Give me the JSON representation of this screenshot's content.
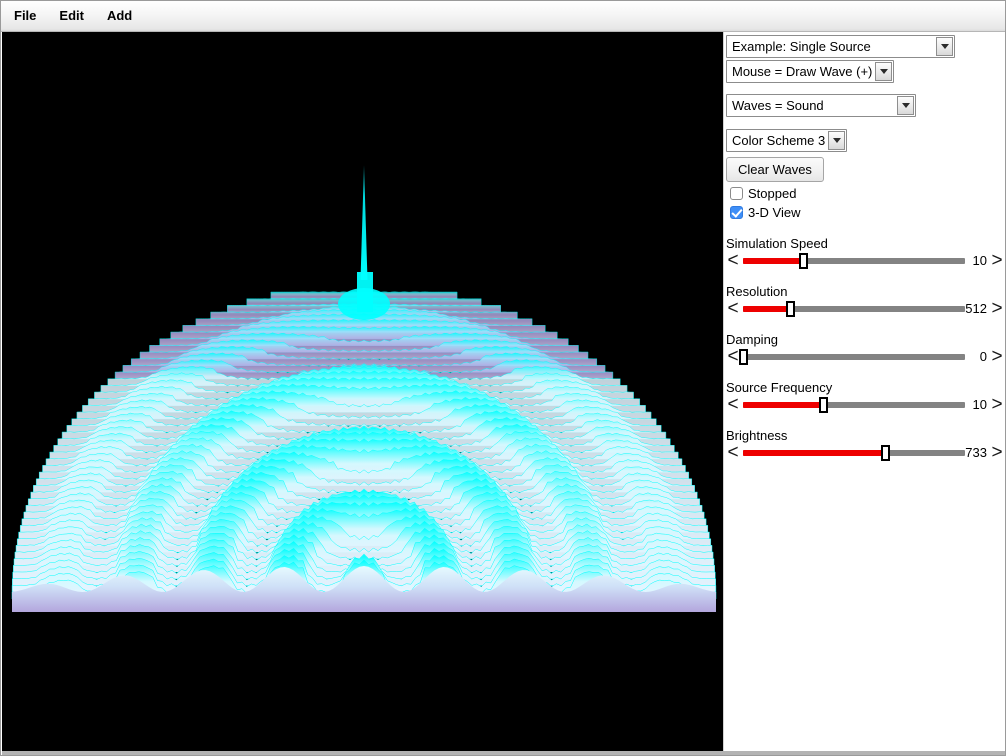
{
  "menubar": {
    "items": [
      {
        "label": "File",
        "name": "menu-file"
      },
      {
        "label": "Edit",
        "name": "menu-edit"
      },
      {
        "label": "Add",
        "name": "menu-add"
      }
    ]
  },
  "panel": {
    "example_select": {
      "value": "Example: Single Source",
      "icon": "chevron-down-icon"
    },
    "mouse_select": {
      "value": "Mouse = Draw Wave (+)",
      "icon": "chevron-down-icon"
    },
    "waves_select": {
      "value": "Waves = Sound",
      "icon": "chevron-down-icon"
    },
    "colorscheme_select": {
      "value": "Color Scheme 3",
      "icon": "chevron-down-icon"
    },
    "clear_button": {
      "label": "Clear Waves"
    },
    "checkboxes": [
      {
        "label": "Stopped",
        "checked": false
      },
      {
        "label": "3-D View",
        "checked": true
      }
    ],
    "sliders": [
      {
        "label": "Simulation Speed",
        "value": "10",
        "fill_percent": 27,
        "left_arrow": "<",
        "right_arrow": ">"
      },
      {
        "label": "Resolution",
        "value": "512",
        "fill_percent": 21,
        "left_arrow": "<",
        "right_arrow": ">"
      },
      {
        "label": "Damping",
        "value": "0",
        "fill_percent": 0,
        "left_arrow": "<",
        "right_arrow": ">"
      },
      {
        "label": "Source Frequency",
        "value": "10",
        "fill_percent": 36,
        "left_arrow": "<",
        "right_arrow": ">"
      },
      {
        "label": "Brightness",
        "value": "733",
        "fill_percent": 64,
        "left_arrow": "<",
        "right_arrow": ">"
      }
    ]
  },
  "canvas": {
    "background_color": "#000000",
    "wave_color_bright": "#00ffff",
    "wave_color_pale": "#d8f7ff",
    "wave_color_shadow": "#b9aee8",
    "description": "3-D ripple tank surface plot: single circular source at center emitting concentric sound waves, rendered as a dome of ridged rings with a tall narrow spike at the source point"
  }
}
